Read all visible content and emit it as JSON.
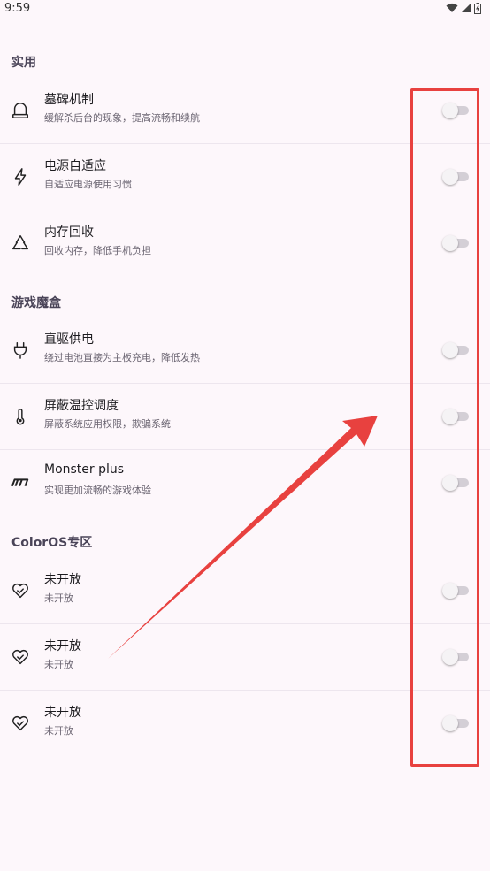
{
  "status_bar": {
    "time": "9:59",
    "icons": [
      "wifi-icon",
      "signal-icon",
      "battery-icon"
    ]
  },
  "colors": {
    "background": "#fdf7fb",
    "annotation_red": "#e8413f",
    "switch_off_track": "#d4cfd6"
  },
  "sections": [
    {
      "title": "实用",
      "items": [
        {
          "icon": "tombstone-icon",
          "title": "墓碑机制",
          "subtitle": "缓解杀后台的现象，提高流畅和续航",
          "enabled": false
        },
        {
          "icon": "lightning-icon",
          "title": "电源自适应",
          "subtitle": "自适应电源使用习惯",
          "enabled": false
        },
        {
          "icon": "recycle-icon",
          "title": "内存回收",
          "subtitle": "回收内存，降低手机负担",
          "enabled": false
        }
      ]
    },
    {
      "title": "游戏魔盒",
      "items": [
        {
          "icon": "plug-icon",
          "title": "直驱供电",
          "subtitle": "绕过电池直接为主板充电，降低发热",
          "enabled": false
        },
        {
          "icon": "thermometer-icon",
          "title": "屏蔽温控调度",
          "subtitle": "屏蔽系统应用权限，欺骗系统",
          "enabled": false
        },
        {
          "icon": "monster-logo-icon",
          "title": "Monster plus",
          "subtitle": "实现更加流畅的游戏体验",
          "enabled": false
        }
      ]
    },
    {
      "title": "ColorOS专区",
      "items": [
        {
          "icon": "heart-check-icon",
          "title": "未开放",
          "subtitle": "未开放",
          "enabled": false
        },
        {
          "icon": "heart-check-icon",
          "title": "未开放",
          "subtitle": "未开放",
          "enabled": false
        },
        {
          "icon": "heart-check-icon",
          "title": "未开放",
          "subtitle": "未开放",
          "enabled": false
        }
      ]
    }
  ]
}
